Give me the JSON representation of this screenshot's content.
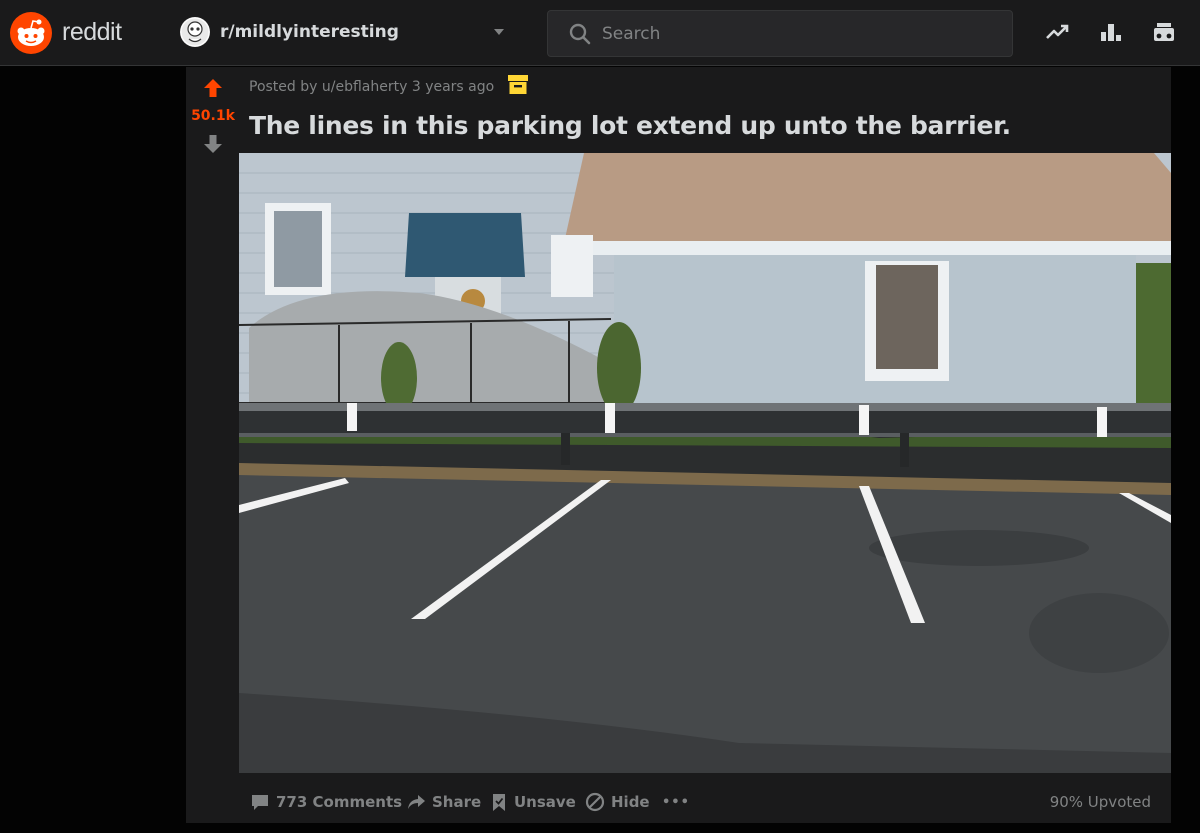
{
  "header": {
    "wordmark": "reddit",
    "subreddit": "r/mildlyinteresting",
    "search_placeholder": "Search",
    "icons": [
      "trending-icon",
      "leaderboard-icon",
      "all-icon"
    ]
  },
  "post": {
    "score": "50.1k",
    "meta_prefix": "Posted by ",
    "author": "u/ebflaherty",
    "age": " 3 years ago",
    "title": "The lines in this parking lot extend up unto the barrier.",
    "image_alt": "parking lot with painted lines extending onto a guardrail",
    "actions": {
      "comments": "773 Comments",
      "share": "Share",
      "unsave": "Unsave",
      "hide": "Hide",
      "more": "•••"
    },
    "upvote_ratio": "90% Upvoted"
  },
  "colors": {
    "brand": "#ff4500",
    "archive_badge": "#ffd635",
    "text": "#d7dadc",
    "muted": "#818384"
  }
}
